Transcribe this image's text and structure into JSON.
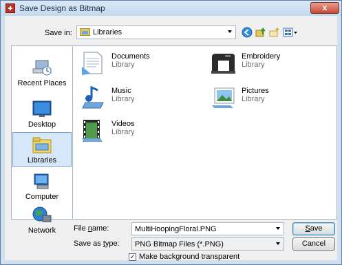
{
  "window": {
    "title": "Save Design as Bitmap",
    "close_label": "x"
  },
  "toolbar": {
    "savein_label": "Save in:",
    "savein_value": "Libraries",
    "back_icon": "back-arrow-icon",
    "up_icon": "up-folder-icon",
    "newfolder_icon": "new-folder-icon",
    "views_icon": "views-menu-icon"
  },
  "places": [
    {
      "label": "Recent Places",
      "icon": "recent-places-icon"
    },
    {
      "label": "Desktop",
      "icon": "desktop-icon"
    },
    {
      "label": "Libraries",
      "icon": "libraries-icon",
      "selected": true
    },
    {
      "label": "Computer",
      "icon": "computer-icon"
    },
    {
      "label": "Network",
      "icon": "network-icon"
    }
  ],
  "libraries": [
    {
      "name": "Documents",
      "sub": "Library",
      "icon": "documents-library-icon"
    },
    {
      "name": "Embroidery",
      "sub": "Library",
      "icon": "sewing-machine-icon"
    },
    {
      "name": "Music",
      "sub": "Library",
      "icon": "music-library-icon"
    },
    {
      "name": "Pictures",
      "sub": "Library",
      "icon": "pictures-library-icon"
    },
    {
      "name": "Videos",
      "sub": "Library",
      "icon": "videos-library-icon"
    }
  ],
  "footer": {
    "filename_label_pre": "File ",
    "filename_label_u": "n",
    "filename_label_post": "ame:",
    "filename_value": "MultiHoopingFloral.PNG",
    "type_label_pre": "Save as ",
    "type_label_u": "t",
    "type_label_post": "ype:",
    "type_value": "PNG Bitmap Files (*.PNG)",
    "save_u": "S",
    "save_rest": "ave",
    "cancel_label": "Cancel",
    "transparent_checked_glyph": "✓",
    "transparent_label": "Make background transparent"
  },
  "colors": {
    "accent": "#3c7fb1",
    "titlebar": "#cfe0f1",
    "close": "#c74a35"
  }
}
